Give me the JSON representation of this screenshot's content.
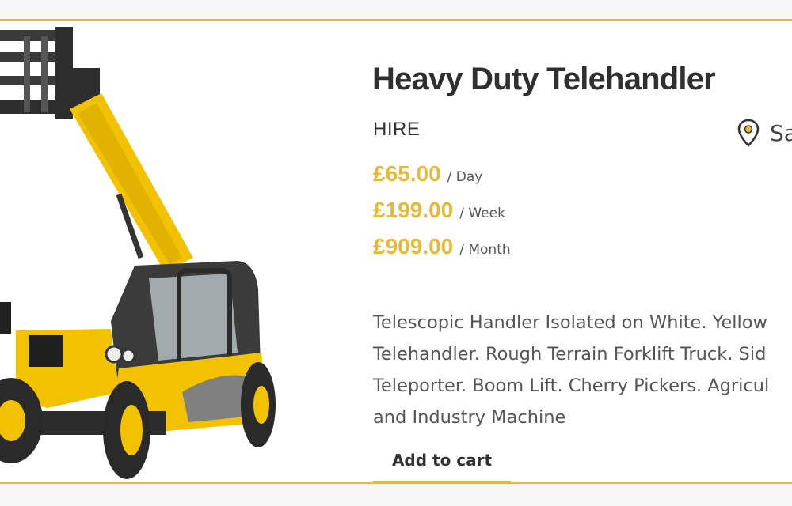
{
  "product": {
    "title": "Heavy Duty Telehandler",
    "category": "HIRE",
    "location_text": "Sa",
    "prices": [
      {
        "amount": "£65.00",
        "period": "/ Day"
      },
      {
        "amount": "£199.00",
        "period": "/ Week"
      },
      {
        "amount": "£909.00",
        "period": "/ Month"
      }
    ],
    "description_lines": [
      "Telescopic Handler Isolated on White. Yellow",
      "Telehandler. Rough Terrain Forklift Truck. Sid",
      "Teleporter. Boom Lift. Cherry Pickers. Agricul",
      "and Industry Machine"
    ],
    "add_to_cart_label": "Add to cart"
  },
  "icons": {
    "location": "map-pin-icon"
  },
  "colors": {
    "accent": "#e6b93a",
    "title": "#2f2f2f",
    "body_text": "#555555"
  }
}
